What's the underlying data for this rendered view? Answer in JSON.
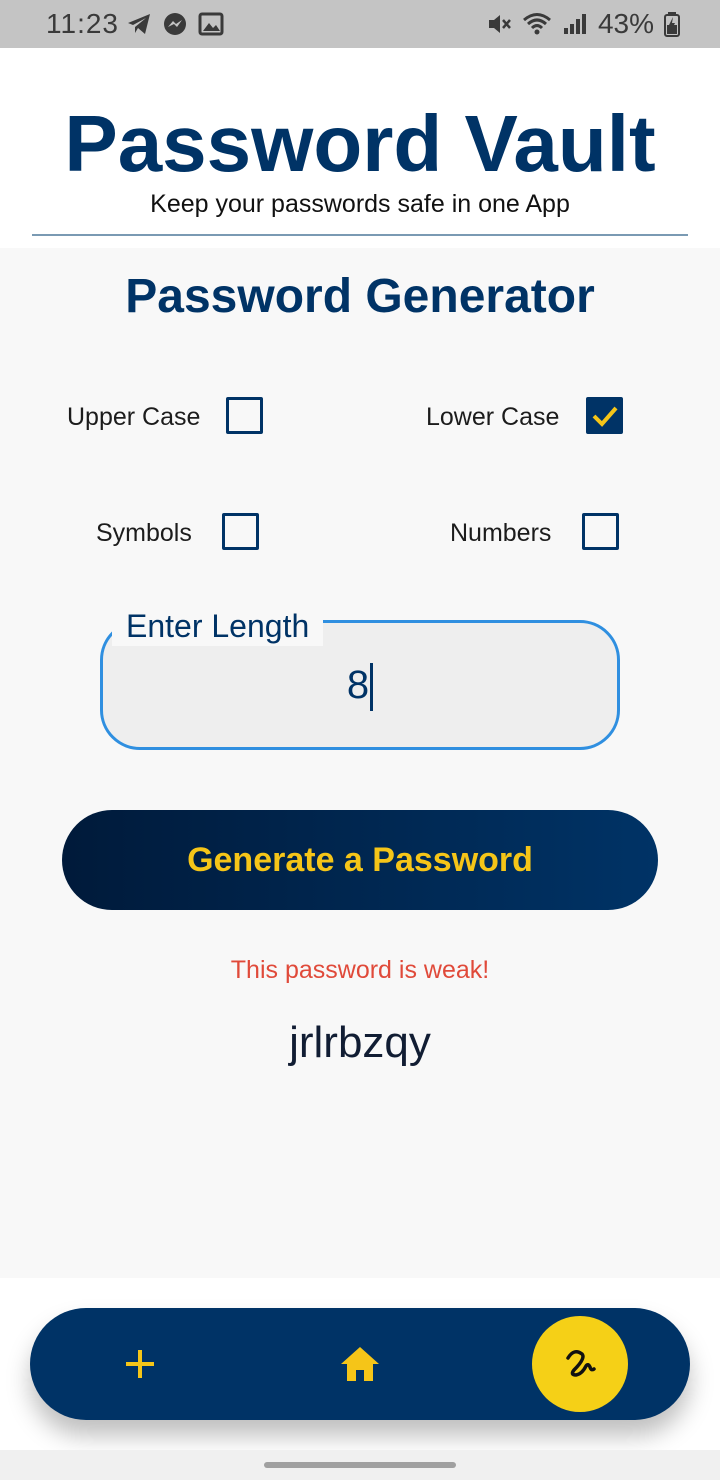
{
  "status_bar": {
    "time": "11:23",
    "left_icons": [
      "telegram-icon",
      "messenger-icon",
      "image-icon"
    ],
    "battery": "43%",
    "right_icons": [
      "mute-icon",
      "wifi-icon",
      "signal-icon",
      "battery-icon"
    ]
  },
  "header": {
    "title": "Password Vault",
    "subtitle": "Keep your passwords safe in one App"
  },
  "generator": {
    "title": "Password Generator",
    "options": [
      {
        "label": "Upper Case",
        "checked": false
      },
      {
        "label": "Lower Case",
        "checked": true
      },
      {
        "label": "Symbols",
        "checked": false
      },
      {
        "label": "Numbers",
        "checked": false
      }
    ],
    "length_label": "Enter Length",
    "length_value": "8",
    "generate_button": "Generate a Password",
    "strength_message": "This password is weak!",
    "generated_password": "jrlrbzqy"
  },
  "bottom_nav": {
    "items": [
      "add-icon",
      "home-icon",
      "generator-icon"
    ],
    "active": "generator-icon"
  },
  "colors": {
    "primary": "#003366",
    "accent": "#f5c518",
    "warning": "#e04a3a",
    "field_border": "#2f8fe0"
  }
}
